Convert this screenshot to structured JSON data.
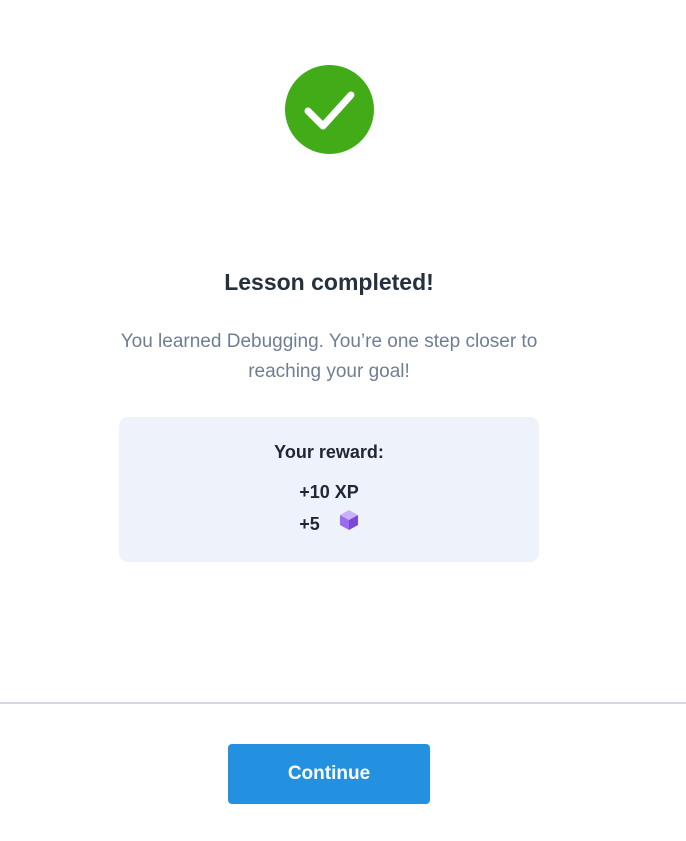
{
  "success_icon": {
    "name": "checkmark-icon",
    "color": "#41ac17"
  },
  "lesson": {
    "title": "Lesson completed!",
    "message": "You learned Debugging. You’re one step closer to reaching your goal!"
  },
  "reward": {
    "title": "Your reward:",
    "xp_text": "+10 XP",
    "gems_text": "+5",
    "gem_icon": "gem-cube-icon"
  },
  "footer": {
    "continue_label": "Continue"
  },
  "colors": {
    "accent": "#2391e0",
    "success": "#41ac17",
    "reward_background": "#edf2fb",
    "gem": "#9a6cf0"
  }
}
